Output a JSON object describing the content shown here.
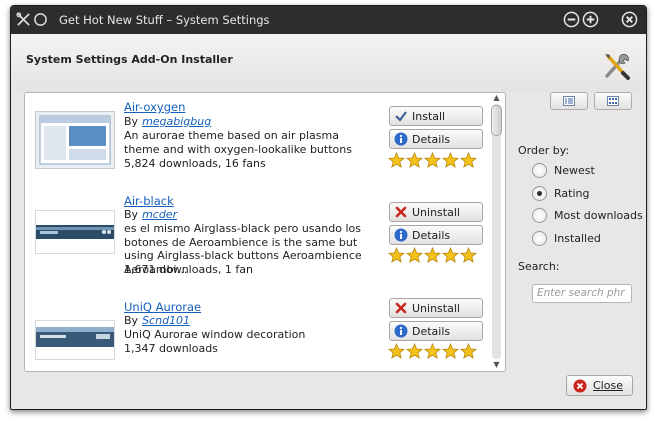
{
  "window": {
    "title": "Get Hot New Stuff – System Settings"
  },
  "header": {
    "title": "System Settings Add-On Installer"
  },
  "items": [
    {
      "title": "Air-oxygen",
      "by_label": "By",
      "author": "megabigbug",
      "description": "An aurorae theme based on air plasma theme and with oxygen-lookalike buttons",
      "stats": "5,824 downloads, 16 fans",
      "action_label": "Install",
      "details_label": "Details",
      "rating": 5
    },
    {
      "title": "Air-black",
      "by_label": "By",
      "author": "mcder",
      "description": "es el mismo Airglass-black pero usando los botones de Aeroambience is the same but using Airglass-black buttons Aeroambience Aeroambi…",
      "stats": "1,671 downloads, 1 fan",
      "action_label": "Uninstall",
      "details_label": "Details",
      "rating": 5
    },
    {
      "title": "UniQ Aurorae",
      "by_label": "By",
      "author": "Scnd101",
      "description": "UniQ Aurorae window decoration",
      "stats": "1,347 downloads",
      "action_label": "Uninstall",
      "details_label": "Details",
      "rating": 5
    }
  ],
  "sidebar": {
    "order_label": "Order by:",
    "options": [
      {
        "label": "Newest",
        "checked": false
      },
      {
        "label": "Rating",
        "checked": true
      },
      {
        "label": "Most downloads",
        "checked": false
      },
      {
        "label": "Installed",
        "checked": false
      }
    ],
    "search_label": "Search:",
    "search_placeholder": "Enter search phr"
  },
  "footer": {
    "close_label": "Close"
  },
  "colors": {
    "titlebar": "#2d2d2d",
    "link": "#1560bd",
    "star": "#f5c21b",
    "uninstall_red": "#c8261d",
    "info_blue": "#2c69c9"
  },
  "icons": [
    "app-tools-icon",
    "minimize-icon",
    "maximize-icon",
    "close-icon",
    "check-icon",
    "info-icon",
    "uninstall-x-icon",
    "star-icon",
    "list-view-icon",
    "grid-view-icon"
  ]
}
